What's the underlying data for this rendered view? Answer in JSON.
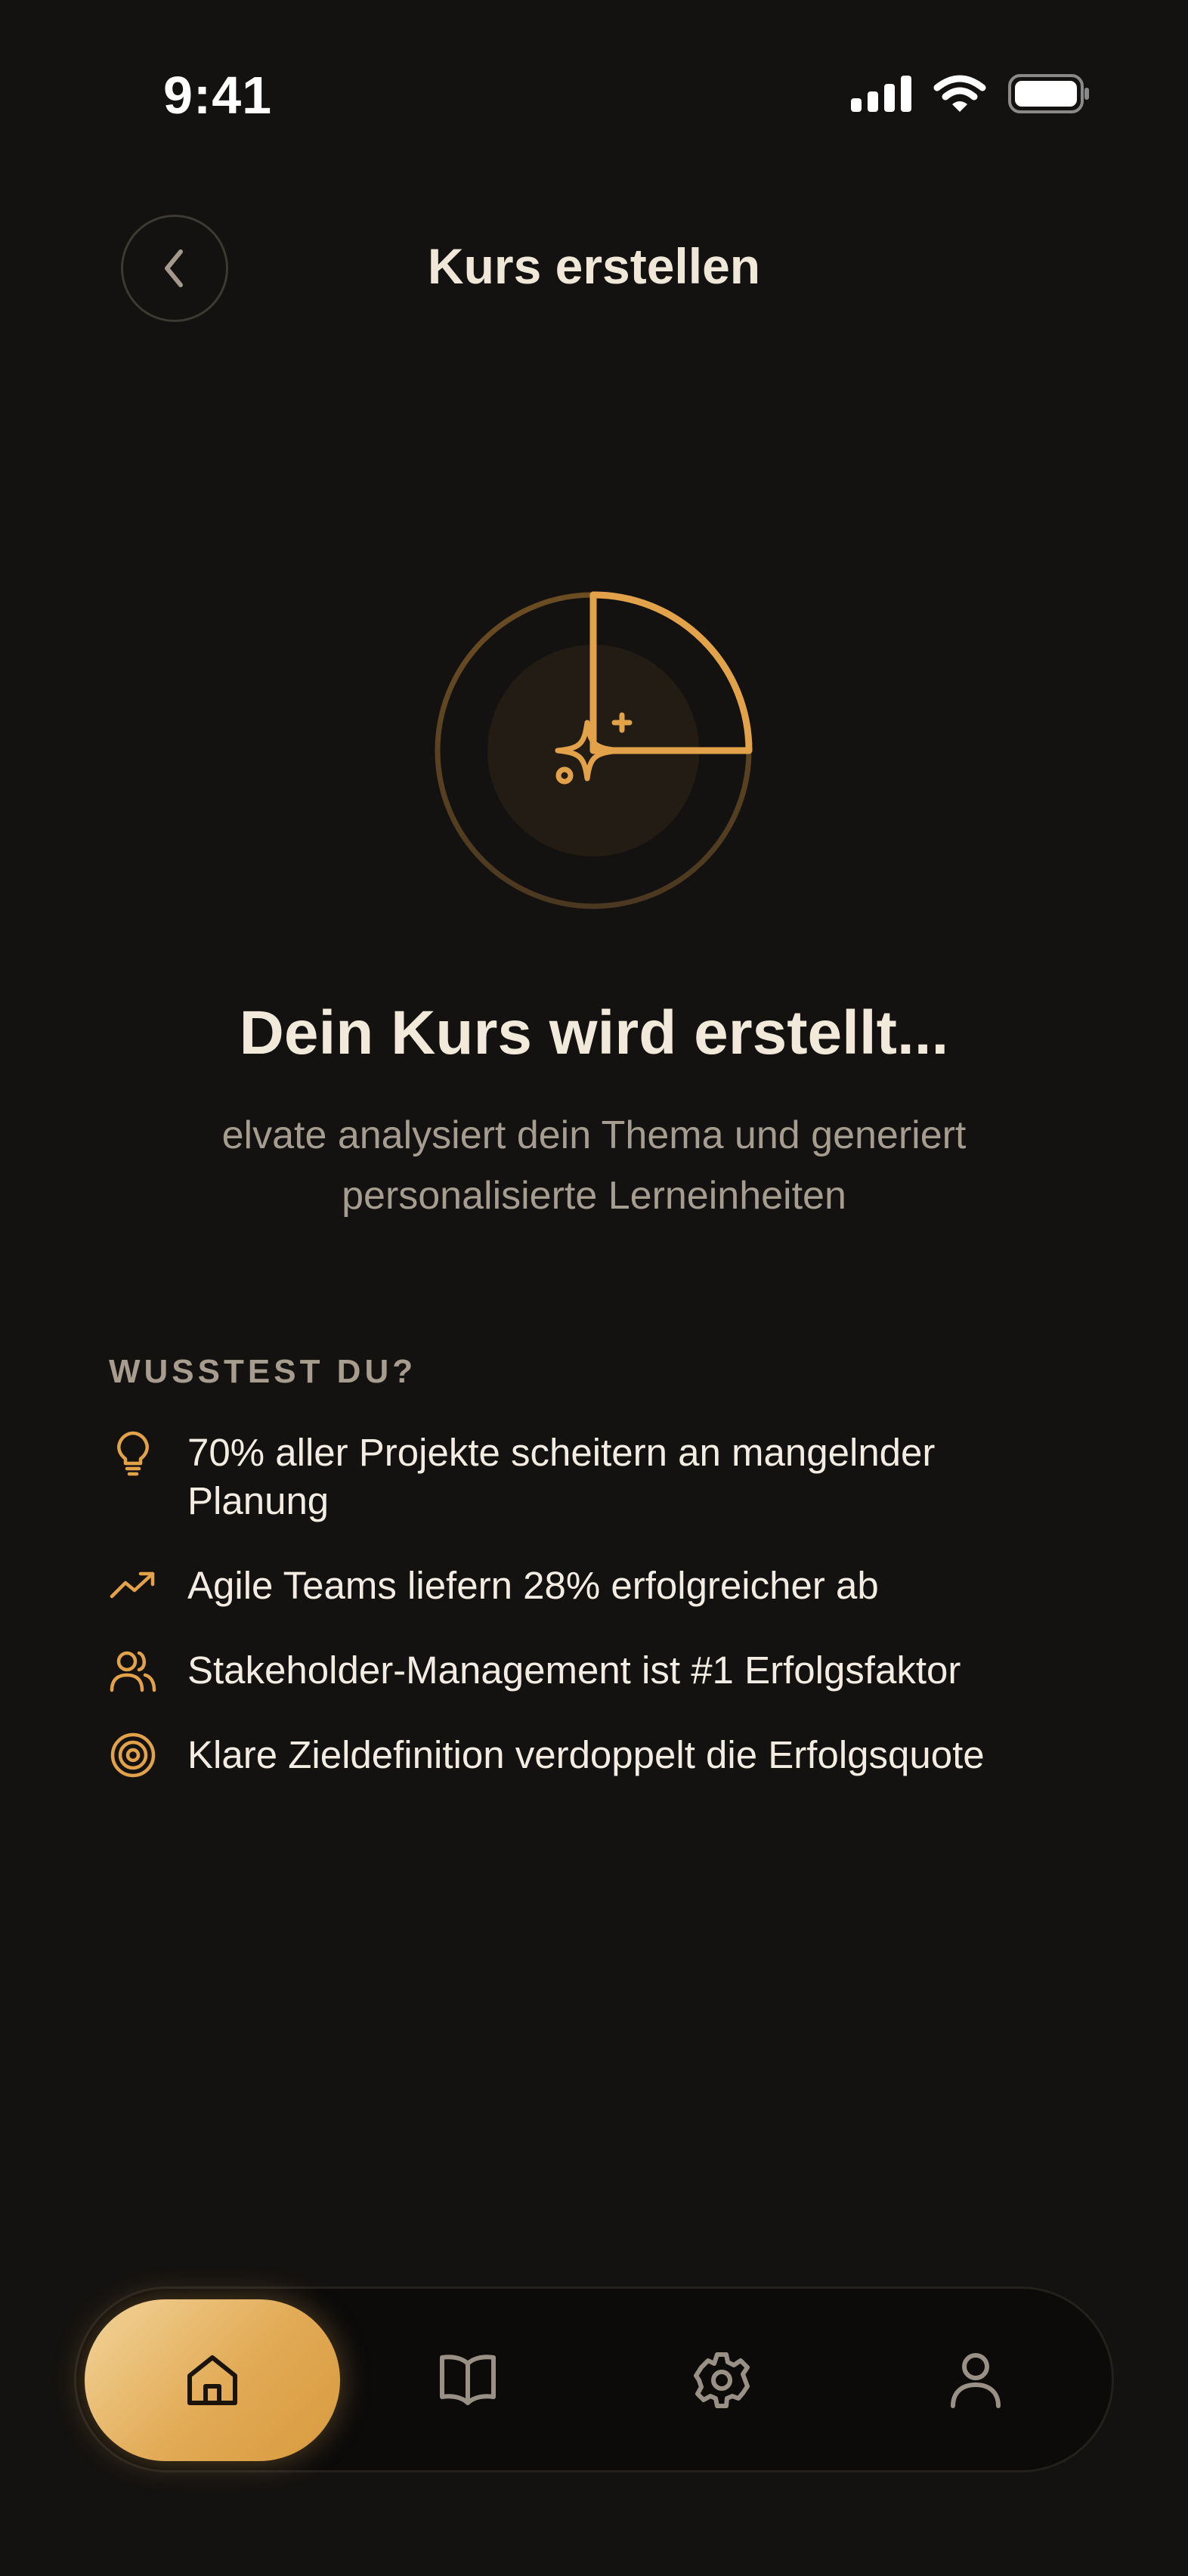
{
  "status_bar": {
    "time": "9:41"
  },
  "header": {
    "title": "Kurs erstellen"
  },
  "loading": {
    "progress": 0.25,
    "headline": "Dein Kurs wird erstellt...",
    "subline_1": "elvate analysiert dein Thema und generiert",
    "subline_2": "personalisierte Lerneinheiten"
  },
  "facts": {
    "title": "WUSSTEST DU?",
    "items": [
      {
        "icon": "lightbulb-icon",
        "text_1": "70% aller Projekte scheitern an mangelnder",
        "text_2": "Planung"
      },
      {
        "icon": "trending-up-icon",
        "text_1": "Agile Teams liefern 28% erfolgreicher ab"
      },
      {
        "icon": "users-icon",
        "text_1": "Stakeholder-Management ist #1 Erfolgsfaktor"
      },
      {
        "icon": "target-icon",
        "text_1": "Klare Zieldefinition verdoppelt die Erfolgsquote"
      }
    ]
  },
  "nav": {
    "items": [
      {
        "icon": "home-icon",
        "active": true
      },
      {
        "icon": "book-icon",
        "active": false
      },
      {
        "icon": "gear-icon",
        "active": false
      },
      {
        "icon": "user-icon",
        "active": false
      }
    ]
  },
  "colors": {
    "accent": "#E2A24A",
    "background": "#141210",
    "text": "#F2ECE2",
    "muted": "#A59D90"
  }
}
